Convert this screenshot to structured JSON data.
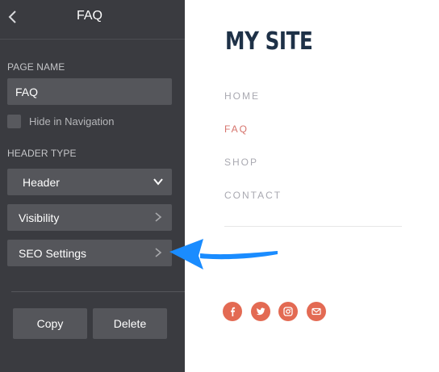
{
  "panel": {
    "title": "FAQ",
    "page_name_label": "PAGE NAME",
    "page_name_value": "FAQ",
    "hide_in_navigation_label": "Hide in Navigation",
    "hide_in_navigation_checked": false,
    "header_type_label": "HEADER TYPE",
    "header_select_value": "Header",
    "visibility_label": "Visibility",
    "seo_settings_label": "SEO Settings",
    "copy_label": "Copy",
    "delete_label": "Delete"
  },
  "preview": {
    "site_title": "MY SITE",
    "nav": [
      {
        "label": "HOME",
        "active": false
      },
      {
        "label": "FAQ",
        "active": true
      },
      {
        "label": "SHOP",
        "active": false
      },
      {
        "label": "CONTACT",
        "active": false
      }
    ],
    "social_icons": [
      "facebook-icon",
      "twitter-icon",
      "instagram-icon",
      "mail-icon"
    ]
  },
  "colors": {
    "panel_bg": "#3a3b40",
    "control_bg": "#55565b",
    "site_title": "#1e3147",
    "nav_inactive": "#a9a9b1",
    "nav_active": "#d6736c",
    "social_bg": "#e36a53",
    "annotation_arrow": "#1a8cff"
  }
}
